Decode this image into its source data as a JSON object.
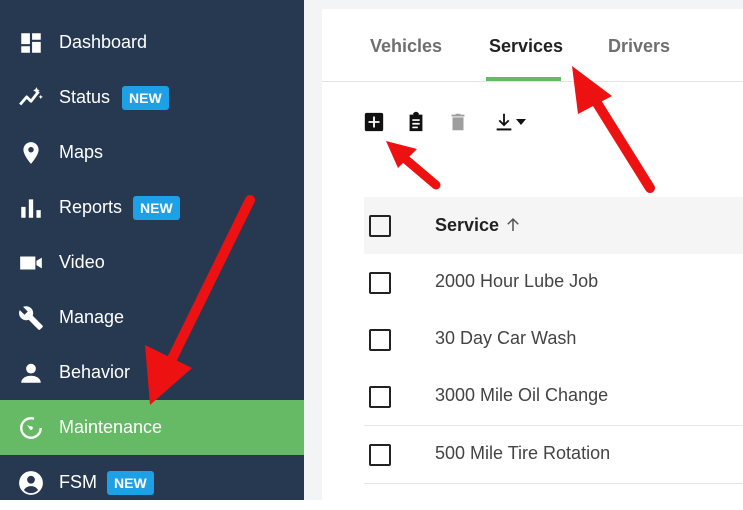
{
  "sidebar": {
    "items": [
      {
        "label": "Dashboard",
        "icon": "dashboard-icon"
      },
      {
        "label": "Status",
        "icon": "status-trend-icon",
        "badge": "NEW"
      },
      {
        "label": "Maps",
        "icon": "map-pin-icon"
      },
      {
        "label": "Reports",
        "icon": "bar-chart-icon",
        "badge": "NEW"
      },
      {
        "label": "Video",
        "icon": "video-camera-icon"
      },
      {
        "label": "Manage",
        "icon": "wrench-icon"
      },
      {
        "label": "Behavior",
        "icon": "person-icon"
      },
      {
        "label": "Maintenance",
        "icon": "maintenance-timer-icon",
        "active": true
      },
      {
        "label": "FSM",
        "icon": "account-circle-icon",
        "badge": "NEW"
      }
    ]
  },
  "tabs": [
    {
      "label": "Vehicles"
    },
    {
      "label": "Services",
      "active": true
    },
    {
      "label": "Drivers"
    }
  ],
  "toolbar": {
    "buttons": [
      "add-box-icon",
      "clipboard-icon",
      "trash-icon",
      "download-icon"
    ]
  },
  "table": {
    "header": "Service",
    "rows": [
      "2000 Hour Lube Job",
      "30 Day Car Wash",
      "3000 Mile Oil Change",
      "500 Mile Tire Rotation"
    ]
  },
  "colors": {
    "sidebar_bg": "#263951",
    "active_green": "#66b965",
    "badge_blue": "#1ea0e6",
    "annotation_red": "#ee1111"
  }
}
